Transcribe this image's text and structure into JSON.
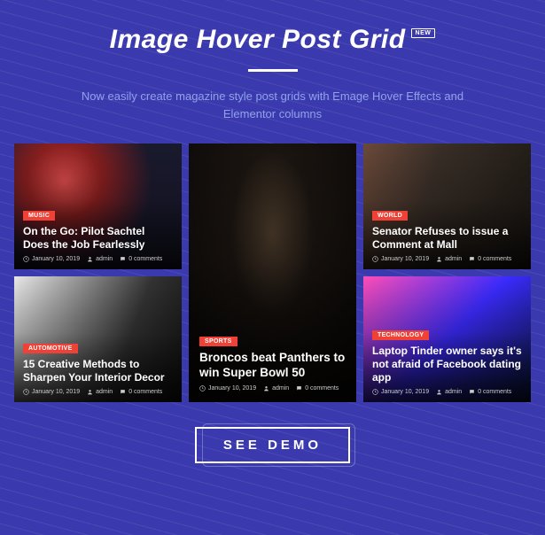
{
  "header": {
    "title": "Image Hover Post Grid",
    "badge": "NEW",
    "subtitle": "Now easily create magazine style post grids with Emage Hover Effects and Elementor columns"
  },
  "cards": {
    "music": {
      "tag": "MUSIC",
      "title": "On the Go: Pilot Sachtel Does the Job Fearlessly",
      "date": "January 10, 2019",
      "author": "admin",
      "comments": "0 comments"
    },
    "auto": {
      "tag": "AUTOMOTIVE",
      "title": "15 Creative Methods to Sharpen Your Interior Decor",
      "date": "January 10, 2019",
      "author": "admin",
      "comments": "0 comments"
    },
    "sports": {
      "tag": "SPORTS",
      "title": "Broncos beat Panthers to win Super Bowl 50",
      "date": "January 10, 2019",
      "author": "admin",
      "comments": "0 comments"
    },
    "world": {
      "tag": "WORLD",
      "title": "Senator Refuses to issue a Comment at Mall",
      "date": "January 10, 2019",
      "author": "admin",
      "comments": "0 comments"
    },
    "tech": {
      "tag": "TECHNOLOGY",
      "title": "Laptop Tinder owner says it's not afraid of Facebook dating app",
      "date": "January 10, 2019",
      "author": "admin",
      "comments": "0 comments"
    }
  },
  "cta": {
    "label": "SEE DEMO"
  }
}
